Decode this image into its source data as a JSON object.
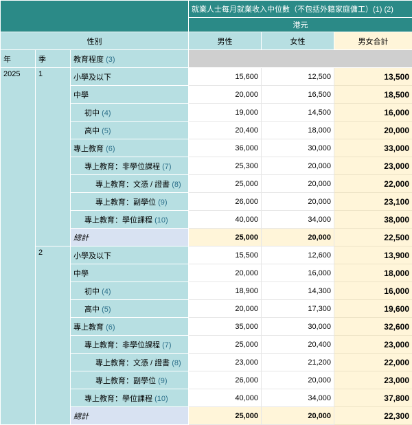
{
  "header": {
    "title": "就業人士每月就業收入中位數（不包括外籍家庭傭工）(1) (2)",
    "unit": "港元"
  },
  "columns": {
    "gender_label": "性別",
    "male": "男性",
    "female": "女性",
    "total": "男女合計"
  },
  "row_headers": {
    "year": "年",
    "quarter": "季",
    "education": "教育程度",
    "education_fn": "(3)"
  },
  "year": "2025",
  "quarters": [
    {
      "label": "1",
      "rows": [
        {
          "label": "小學及以下",
          "fn": "",
          "level": 0,
          "male": "15,600",
          "female": "12,500",
          "total": "13,500"
        },
        {
          "label": "中學",
          "fn": "",
          "level": 0,
          "male": "20,000",
          "female": "16,500",
          "total": "18,500"
        },
        {
          "label": "初中",
          "fn": "(4)",
          "level": 1,
          "male": "19,000",
          "female": "14,500",
          "total": "16,000"
        },
        {
          "label": "高中",
          "fn": "(5)",
          "level": 1,
          "male": "20,400",
          "female": "18,000",
          "total": "20,000"
        },
        {
          "label": "專上教育",
          "fn": "(6)",
          "level": 0,
          "male": "36,000",
          "female": "30,000",
          "total": "33,000"
        },
        {
          "label": "專上教育：非學位課程",
          "fn": "(7)",
          "level": 1,
          "male": "25,300",
          "female": "20,000",
          "total": "23,000"
        },
        {
          "label": "專上教育：文憑 / 證書",
          "fn": "(8)",
          "level": 2,
          "male": "25,000",
          "female": "20,000",
          "total": "22,000"
        },
        {
          "label": "專上教育：副學位",
          "fn": "(9)",
          "level": 2,
          "male": "26,000",
          "female": "20,000",
          "total": "23,100"
        },
        {
          "label": "專上教育：學位課程",
          "fn": "(10)",
          "level": 1,
          "male": "40,000",
          "female": "34,000",
          "total": "38,000"
        }
      ],
      "sum": {
        "label": "總計",
        "male": "25,000",
        "female": "20,000",
        "total": "22,500"
      }
    },
    {
      "label": "2",
      "rows": [
        {
          "label": "小學及以下",
          "fn": "",
          "level": 0,
          "male": "15,500",
          "female": "12,600",
          "total": "13,900"
        },
        {
          "label": "中學",
          "fn": "",
          "level": 0,
          "male": "20,000",
          "female": "16,000",
          "total": "18,000"
        },
        {
          "label": "初中",
          "fn": "(4)",
          "level": 1,
          "male": "18,900",
          "female": "14,300",
          "total": "16,000"
        },
        {
          "label": "高中",
          "fn": "(5)",
          "level": 1,
          "male": "20,000",
          "female": "17,300",
          "total": "19,600"
        },
        {
          "label": "專上教育",
          "fn": "(6)",
          "level": 0,
          "male": "35,000",
          "female": "30,000",
          "total": "32,600"
        },
        {
          "label": "專上教育：非學位課程",
          "fn": "(7)",
          "level": 1,
          "male": "25,000",
          "female": "20,400",
          "total": "23,000"
        },
        {
          "label": "專上教育：文憑 / 證書",
          "fn": "(8)",
          "level": 2,
          "male": "23,000",
          "female": "21,200",
          "total": "22,000"
        },
        {
          "label": "專上教育：副學位",
          "fn": "(9)",
          "level": 2,
          "male": "26,000",
          "female": "20,000",
          "total": "23,000"
        },
        {
          "label": "專上教育：學位課程",
          "fn": "(10)",
          "level": 1,
          "male": "40,000",
          "female": "34,000",
          "total": "37,800"
        }
      ],
      "sum": {
        "label": "總計",
        "male": "25,000",
        "female": "20,000",
        "total": "22,300"
      }
    }
  ]
}
